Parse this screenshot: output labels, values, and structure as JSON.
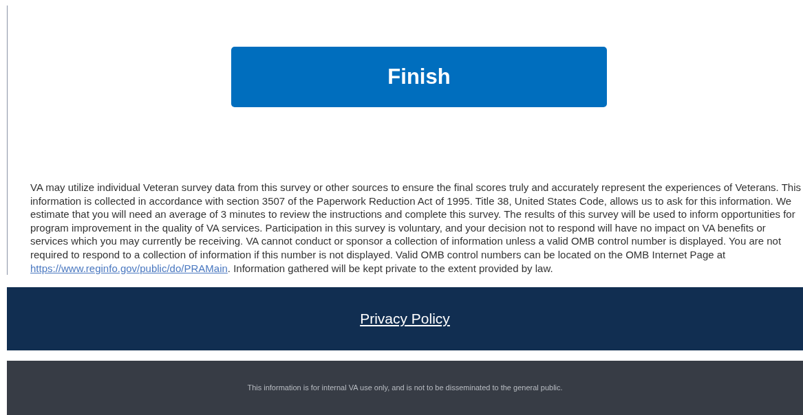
{
  "finish_button": {
    "label": "Finish"
  },
  "disclaimer": {
    "text_before_link": "VA may utilize individual Veteran survey data from this survey or other sources to ensure the final scores truly and accurately represent the experiences of Veterans. This information is collected in accordance with section 3507 of the Paperwork Reduction Act of 1995. Title 38, United States Code, allows us to ask for this information. We estimate that you will need an average of 3 minutes to review the instructions and complete this survey. The results of this survey will be used to inform opportunities for program improvement in the quality of VA services. Participation in this survey is voluntary, and your decision not to respond will have no impact on VA benefits or services which you may currently be receiving. VA cannot conduct or sponsor a collection of information unless a valid OMB control number is displayed. You are not required to respond to a collection of information if this number is not displayed. Valid OMB control numbers can be located on the OMB Internet Page at",
    "link": "https://www.reginfo.gov/public/do/PRAMain",
    "text_after_link": ". Information gathered will be kept private to the extent provided by law."
  },
  "footer": {
    "link": "Privacy Policy"
  },
  "notice_bar": {
    "text": "This information is for internal VA use only, and is not to be disseminated to the general public."
  }
}
